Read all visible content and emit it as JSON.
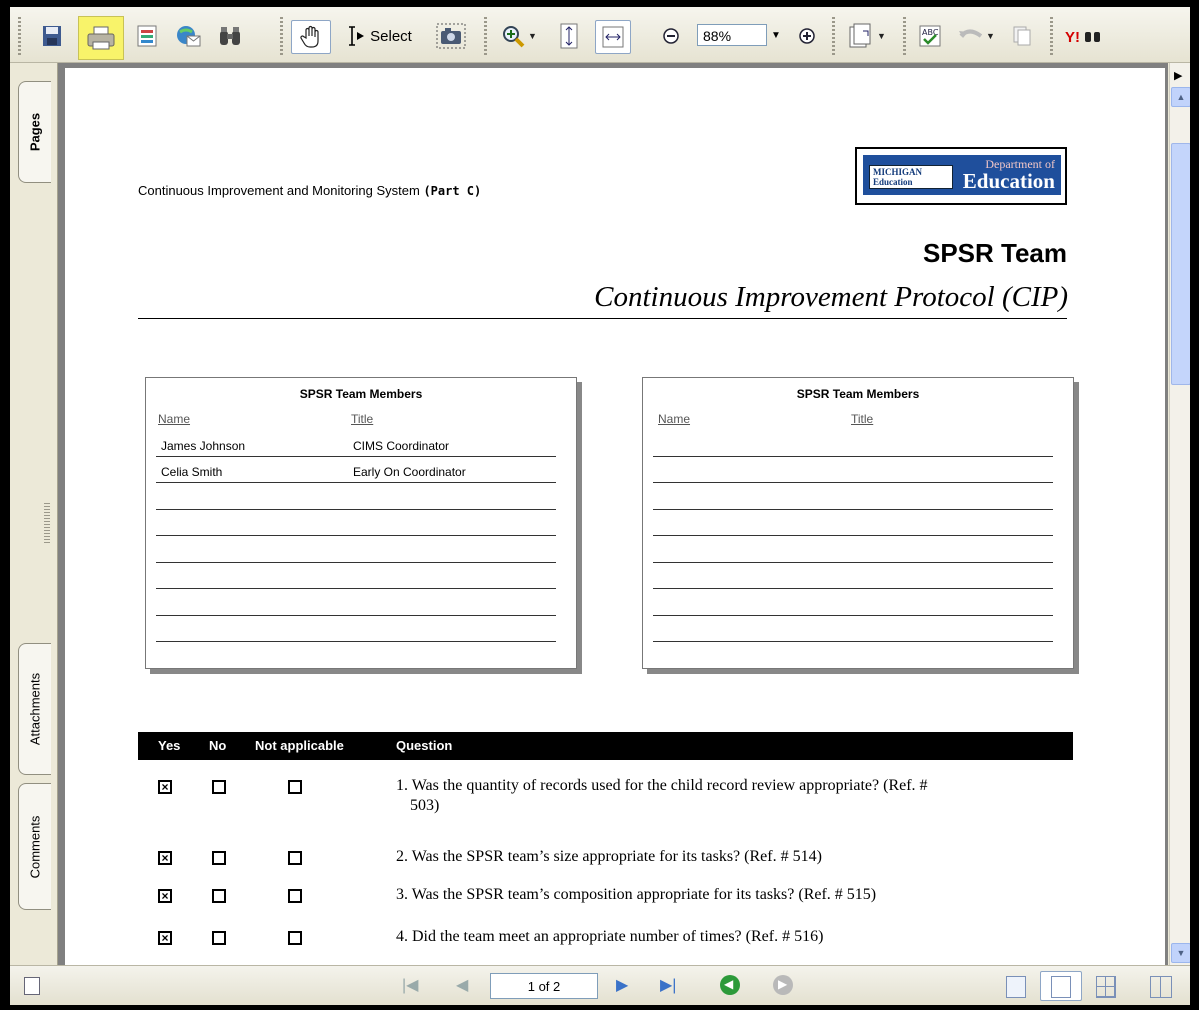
{
  "toolbar": {
    "select_label": "Select",
    "zoom_value": "88%",
    "icons": [
      "save-icon",
      "print-icon",
      "organizer-icon",
      "email-icon",
      "search-binoculars-icon",
      "hand-tool-icon",
      "select-tool-icon",
      "snapshot-icon",
      "zoom-in-icon",
      "actual-size-icon",
      "fit-width-icon",
      "zoom-out-icon",
      "zoom-in-plus-icon",
      "page-rotate-icon",
      "spellcheck-icon",
      "undo-icon",
      "copy-icon",
      "yahoo-icon"
    ]
  },
  "nav_tabs": [
    "Pages",
    "Attachments",
    "Comments"
  ],
  "statusbar": {
    "page_display": "1 of 2"
  },
  "document": {
    "header_left": "Continuous Improvement and Monitoring System",
    "header_part": "(Part C)",
    "logo": {
      "left": "MICHIGAN Education",
      "right_top": "Department of",
      "right_bottom": "Education"
    },
    "title": "SPSR Team",
    "subtitle": "Continuous Improvement Protocol (CIP)",
    "members_left": {
      "title": "SPSR Team Members",
      "name_header": "Name",
      "title_header": "Title",
      "rows": [
        {
          "name": "James Johnson",
          "title": "CIMS Coordinator"
        },
        {
          "name": "Celia Smith",
          "title": "Early On Coordinator"
        }
      ]
    },
    "members_right": {
      "title": "SPSR Team Members",
      "name_header": "Name",
      "title_header": "Title"
    },
    "question_table": {
      "headers": {
        "yes": "Yes",
        "no": "No",
        "na": "Not applicable",
        "question": "Question"
      },
      "rows": [
        {
          "q": "1. Was the quantity of records used for the child record review appropriate? (Ref. #",
          "q2": "503)",
          "answer": "yes"
        },
        {
          "q": "2. Was the SPSR team’s size appropriate for its tasks? (Ref. # 514)",
          "answer": "yes"
        },
        {
          "q": "3. Was the SPSR team’s composition appropriate for its tasks? (Ref. # 515)",
          "answer": "yes"
        },
        {
          "q": "4. Did the team meet an appropriate number of times? (Ref. # 516)",
          "answer": "yes"
        }
      ]
    }
  }
}
